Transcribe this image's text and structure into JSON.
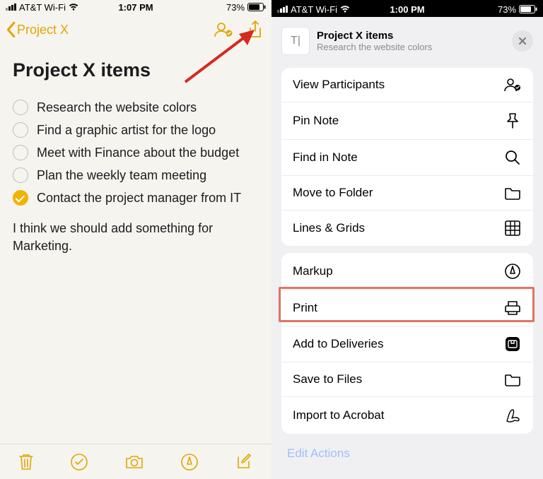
{
  "left": {
    "status": {
      "carrier": "AT&T Wi-Fi",
      "time": "1:07 PM",
      "battery": "73%"
    },
    "nav_back": "Project X",
    "note_title": "Project X items",
    "checklist": [
      {
        "label": "Research the website colors",
        "done": false
      },
      {
        "label": "Find a graphic artist for the logo",
        "done": false
      },
      {
        "label": "Meet with Finance about the budget",
        "done": false
      },
      {
        "label": "Plan the weekly team meeting",
        "done": false
      },
      {
        "label": "Contact the project manager from IT",
        "done": true
      }
    ],
    "body_text": "I think we should add something for Marketing."
  },
  "right": {
    "status": {
      "carrier": "AT&T Wi-Fi",
      "time": "1:00 PM",
      "battery": "73%"
    },
    "header": {
      "title": "Project X items",
      "subtitle": "Research the website colors"
    },
    "group1": [
      {
        "label": "View Participants",
        "icon": "participants"
      },
      {
        "label": "Pin Note",
        "icon": "pin"
      },
      {
        "label": "Find in Note",
        "icon": "search"
      },
      {
        "label": "Move to Folder",
        "icon": "folder"
      },
      {
        "label": "Lines & Grids",
        "icon": "grid"
      }
    ],
    "group2": [
      {
        "label": "Markup",
        "icon": "markup"
      },
      {
        "label": "Print",
        "icon": "print"
      },
      {
        "label": "Add to Deliveries",
        "icon": "deliveries"
      },
      {
        "label": "Save to Files",
        "icon": "folder"
      },
      {
        "label": "Import to Acrobat",
        "icon": "acrobat"
      }
    ],
    "edit_actions": "Edit Actions"
  }
}
